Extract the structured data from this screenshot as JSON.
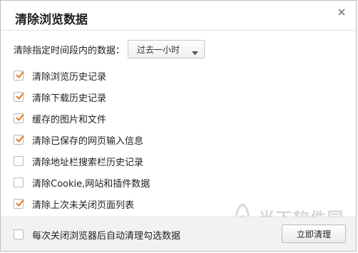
{
  "dialog": {
    "title": "清除浏览数据",
    "close_icon": "close-icon"
  },
  "time_range": {
    "label": "清除指定时间段内的数据：",
    "selected": "过去一小时"
  },
  "options": [
    {
      "label": "清除浏览历史记录",
      "checked": true
    },
    {
      "label": "清除下载历史记录",
      "checked": true
    },
    {
      "label": "缓存的图片和文件",
      "checked": true
    },
    {
      "label": "清除已保存的网页输入信息",
      "checked": true
    },
    {
      "label": "清除地址栏搜索栏历史记录",
      "checked": false
    },
    {
      "label": "清除Cookie,网站和插件数据",
      "checked": false
    },
    {
      "label": "清除上次未关闭页面列表",
      "checked": true
    }
  ],
  "footer": {
    "auto_clear_label": "每次关闭浏览器后自动清理勾选数据",
    "auto_clear_checked": false,
    "clear_button": "立即清理"
  },
  "watermark": {
    "text": "当下软件园"
  },
  "colors": {
    "check": "#e07a1f",
    "footer_bg": "#f2f2f2"
  }
}
